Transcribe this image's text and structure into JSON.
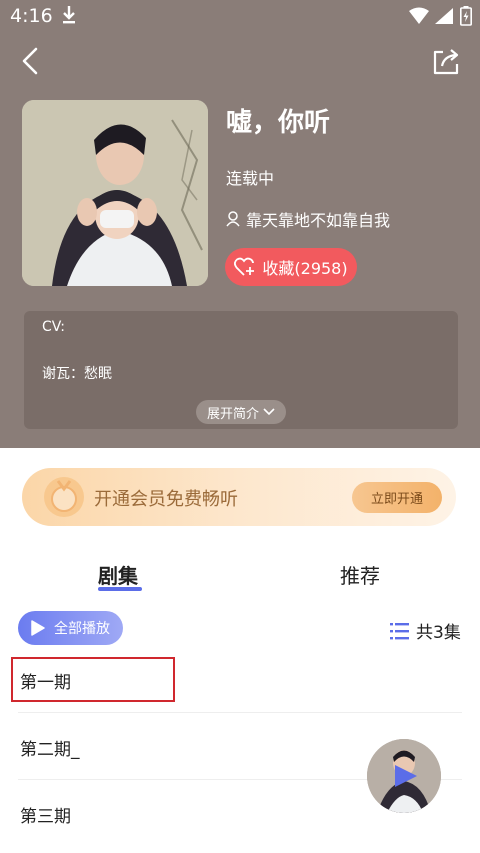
{
  "status_bar": {
    "time": "4:16"
  },
  "album": {
    "title": "嘘，你听",
    "status": "连载中",
    "author": "靠天靠地不如靠自我",
    "favorite_label": "收藏(2958)"
  },
  "intro": {
    "cv_label": "CV:",
    "voice_line": "谢瓦：愁眠",
    "expand_label": "展开简介"
  },
  "vip": {
    "text": "开通会员免费畅听",
    "button": "立即开通"
  },
  "tabs": [
    {
      "label": "剧集",
      "active": true
    },
    {
      "label": "推荐",
      "active": false
    }
  ],
  "episodes_bar": {
    "play_all": "全部播放",
    "count": "共3集"
  },
  "episodes": [
    {
      "title": "第一期"
    },
    {
      "title": "第二期_"
    },
    {
      "title": "第三期"
    }
  ],
  "colors": {
    "header_bg": "#8a7d78",
    "accent": "#5b6de8",
    "favorite": "#f25a5e"
  }
}
